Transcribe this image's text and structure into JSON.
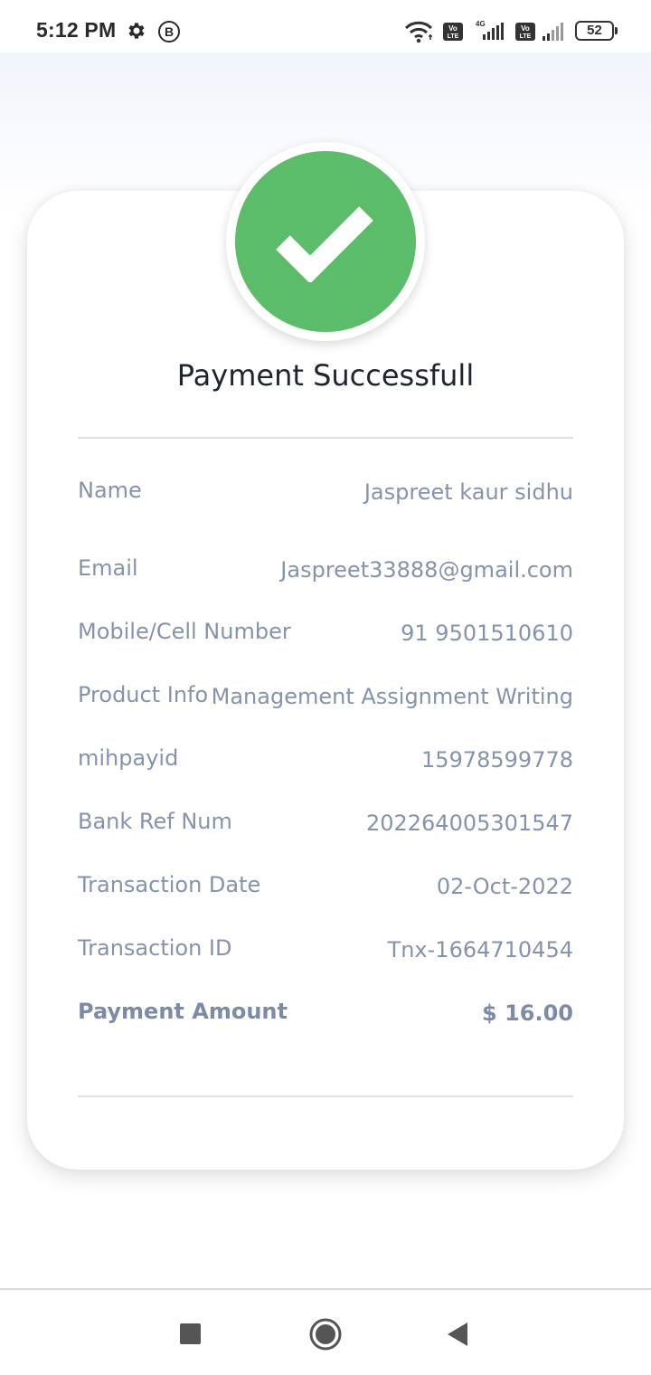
{
  "status_bar": {
    "time": "5:12 PM",
    "battery": "52",
    "network_label": "4G",
    "volte_label": "Vo LTE",
    "icons": [
      "gear-icon",
      "b-circle-icon",
      "wifi-icon",
      "volte-icon",
      "signal-icon",
      "battery-icon"
    ]
  },
  "payment": {
    "title": "Payment Successfull",
    "status_color": "#5bbd69",
    "rows": [
      {
        "label": "Name",
        "value": "Jaspreet kaur sidhu"
      },
      {
        "label": "Email",
        "value": "Jaspreet33888@gmail.com"
      },
      {
        "label": "Mobile/Cell Number",
        "value": "91 9501510610"
      },
      {
        "label": "Product Info",
        "value": "Management Assignment Writing"
      },
      {
        "label": "mihpayid",
        "value": "15978599778"
      },
      {
        "label": "Bank Ref Num",
        "value": "202264005301547"
      },
      {
        "label": "Transaction Date",
        "value": "02-Oct-2022"
      },
      {
        "label": "Transaction ID",
        "value": "Tnx-1664710454"
      },
      {
        "label": "Payment Amount",
        "value": "$ 16.00"
      }
    ]
  },
  "nav": {
    "icons": [
      "recents-square-icon",
      "home-circle-icon",
      "back-triangle-icon"
    ]
  }
}
